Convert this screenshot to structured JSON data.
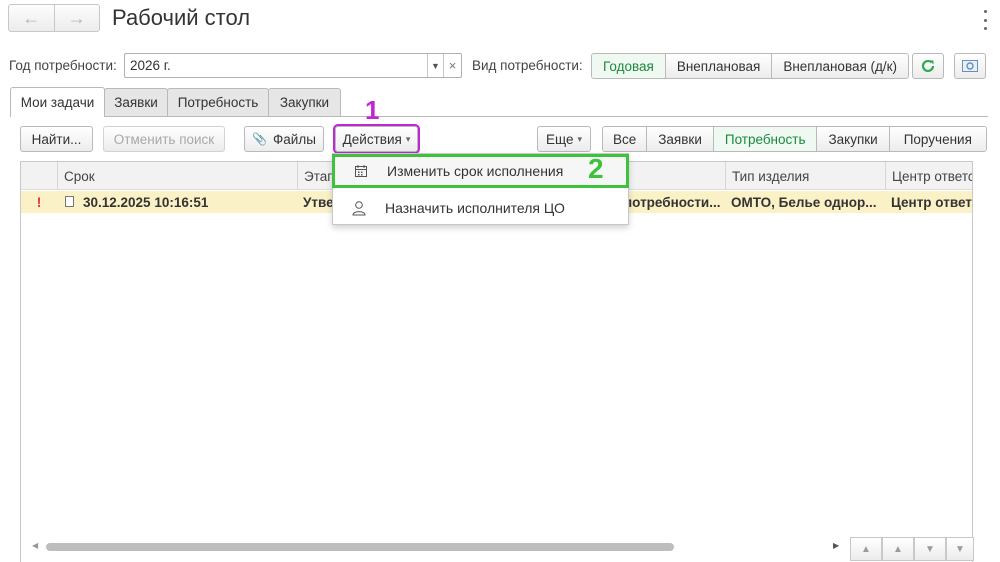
{
  "window": {
    "title": "Рабочий стол",
    "back_icon": "arrow-left-icon",
    "forward_icon": "arrow-right-icon",
    "more_icon": "kebab-menu-icon"
  },
  "filters": {
    "year_label": "Год потребности:",
    "year_value": "2026 г.",
    "need_type_label": "Вид потребности:",
    "need_types": [
      "Годовая",
      "Внеплановая",
      "Внеплановая (д/к)"
    ],
    "need_type_selected": "Годовая",
    "refresh_icon": "refresh-icon",
    "settings_icon": "report-settings-icon"
  },
  "tabs": [
    "Мои задачи",
    "Заявки",
    "Потребность",
    "Закупки"
  ],
  "tabs_active": "Мои задачи",
  "toolbar": {
    "find": "Найти...",
    "cancel_search": "Отменить поиск",
    "files": "Файлы",
    "actions": "Действия",
    "more": "Еще",
    "filter_segments": [
      "Все",
      "Заявки",
      "Потребность",
      "Закупки",
      "Поручения"
    ],
    "filter_selected": "Потребность"
  },
  "table": {
    "columns": [
      "Срок",
      "Этап",
      "Тип изделия",
      "Центр ответс"
    ],
    "rows": [
      {
        "flag": "!",
        "deadline": "30.12.2025 10:16:51",
        "stage": "Утве",
        "hidden_part": "потребности...",
        "item_type": "ОМТО, Белье однор...",
        "center": "Центр ответс"
      }
    ]
  },
  "actions_menu": {
    "items": [
      {
        "label": "Изменить срок исполнения",
        "icon": "calendar-icon"
      },
      {
        "label": "Назначить исполнителя ЦО",
        "icon": "user-icon"
      }
    ]
  },
  "annotations": {
    "marker_1": "1",
    "marker_2": "2",
    "marker_1_color": "#c026d3",
    "marker_2_color": "#3ec23e"
  },
  "colors": {
    "accent_green": "#1a8a3c",
    "selected_row": "#fbf1c7",
    "flag_red": "#e03030"
  }
}
